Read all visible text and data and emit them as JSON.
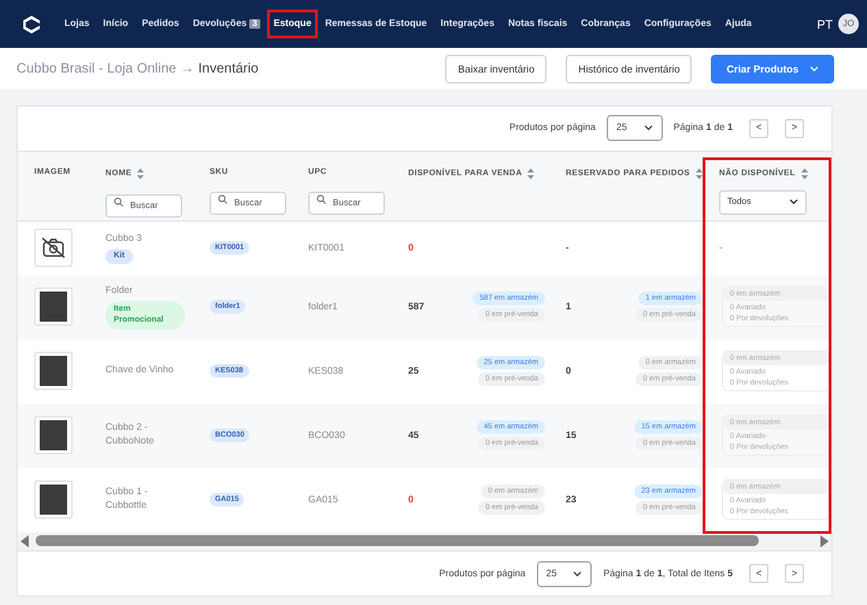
{
  "nav": {
    "items": [
      {
        "label": "Lojas",
        "selected": false,
        "highlighted": false
      },
      {
        "label": "Início",
        "selected": false,
        "highlighted": false
      },
      {
        "label": "Pedidos",
        "selected": false,
        "highlighted": false
      },
      {
        "label": "Devoluções",
        "badge": "3",
        "selected": false,
        "highlighted": false
      },
      {
        "label": "Estoque",
        "selected": true,
        "highlighted": true
      },
      {
        "label": "Remessas de Estoque",
        "selected": false,
        "highlighted": false
      },
      {
        "label": "Integrações",
        "selected": false,
        "highlighted": false
      },
      {
        "label": "Notas fiscais",
        "selected": false,
        "highlighted": false
      },
      {
        "label": "Cobranças",
        "selected": false,
        "highlighted": false
      },
      {
        "label": "Configurações",
        "selected": false,
        "highlighted": false
      },
      {
        "label": "Ajuda",
        "selected": false,
        "highlighted": false
      }
    ],
    "language": "PT",
    "avatar": "JO"
  },
  "header": {
    "breadcrumb": [
      "Cubbo Brasil - Loja Online",
      "→",
      "Inventário"
    ],
    "buttons": [
      {
        "label": "Baixar inventário",
        "kind": "outline"
      },
      {
        "label": "Histórico de inventário",
        "kind": "outline"
      },
      {
        "label": "Criar Produtos",
        "kind": "primary"
      }
    ]
  },
  "top_pagination": {
    "per_page_label": "Produtos por página",
    "per_page": "25",
    "page_text": "Página **1** de **1**",
    "prev": "<",
    "next": ">"
  },
  "table": {
    "highlight": {
      "kind": "last-column"
    },
    "columns": [
      {
        "label": "IMAGEM",
        "sortable": false
      },
      {
        "label": "NOME",
        "sortable": true,
        "filter": {
          "kind": "search",
          "placeholder": "Buscar"
        }
      },
      {
        "label": "SKU",
        "sortable": false,
        "filter": {
          "kind": "search",
          "placeholder": "Buscar"
        }
      },
      {
        "label": "UPC",
        "sortable": false,
        "filter": {
          "kind": "search",
          "placeholder": "Buscar"
        }
      },
      {
        "label": "DISPONÍVEL PARA VENDA",
        "sortable": true
      },
      {
        "label": "RESERVADO PARA PEDIDOS",
        "sortable": true
      },
      {
        "label": "NÃO DISPONÍVEL",
        "sortable": true,
        "filter": {
          "kind": "select",
          "value": "Todos"
        }
      }
    ],
    "rows": [
      {
        "kind": "no-image",
        "name": "Cubbo 3",
        "tag": {
          "label": "Kit",
          "kind": "kit"
        },
        "sku": "KIT0001",
        "upc": "KIT0001",
        "available": {
          "value": "0",
          "alert": true
        },
        "reserved": {
          "value": "-"
        },
        "unavailable": {
          "dash": "-"
        }
      },
      {
        "kind": "photo",
        "name": "Folder",
        "tag": {
          "label": "Item Promocional",
          "kind": "promo"
        },
        "sku": "folder1",
        "upc": "folder1",
        "available": {
          "value": "587",
          "alert": false,
          "pills": [
            {
              "label": "587 em armazém",
              "highlighted": true
            },
            {
              "label": "0 em pré-venda",
              "highlighted": false
            }
          ]
        },
        "reserved": {
          "value": "1",
          "pills": [
            {
              "label": "1 em armazém",
              "highlighted": true
            },
            {
              "label": "0 em pré-venda",
              "highlighted": false
            }
          ]
        },
        "unavailable": {
          "lines": [
            "0 em armazém",
            "0 Avariado",
            "0 Por devoluções"
          ]
        }
      },
      {
        "kind": "photo",
        "name": "Chave de Vinho",
        "sku": "KES038",
        "upc": "KES038",
        "available": {
          "value": "25",
          "alert": false,
          "pills": [
            {
              "label": "25 em armazém",
              "highlighted": true
            },
            {
              "label": "0 em pré-venda",
              "highlighted": false
            }
          ]
        },
        "reserved": {
          "value": "0",
          "pills": [
            {
              "label": "0 em armazém",
              "highlighted": false
            },
            {
              "label": "0 em pré-venda",
              "highlighted": false
            }
          ]
        },
        "unavailable": {
          "lines": [
            "0 em armazém",
            "0 Avariado",
            "0 Por devoluções"
          ]
        }
      },
      {
        "kind": "photo",
        "name": "Cubbo 2 - CubboNote",
        "sku": "BCO030",
        "upc": "BCO030",
        "available": {
          "value": "45",
          "alert": false,
          "pills": [
            {
              "label": "45 em armazém",
              "highlighted": true
            },
            {
              "label": "0 em pré-venda",
              "highlighted": false
            }
          ]
        },
        "reserved": {
          "value": "15",
          "pills": [
            {
              "label": "15 em armazém",
              "highlighted": true
            },
            {
              "label": "0 em pré-venda",
              "highlighted": false
            }
          ]
        },
        "unavailable": {
          "lines": [
            "0 em armazém",
            "0 Avariado",
            "0 Por devoluções"
          ]
        }
      },
      {
        "kind": "photo",
        "name": "Cubbo 1 - Cubbottle",
        "sku": "GA015",
        "upc": "GA015",
        "available": {
          "value": "0",
          "alert": true,
          "pills": [
            {
              "label": "0 em armazém",
              "highlighted": false
            },
            {
              "label": "0 em pré-venda",
              "highlighted": false
            }
          ]
        },
        "reserved": {
          "value": "23",
          "pills": [
            {
              "label": "23 em armazém",
              "highlighted": true
            },
            {
              "label": "0 em pré-venda",
              "highlighted": false
            }
          ]
        },
        "unavailable": {
          "lines": [
            "0 em armazém",
            "0 Avariado",
            "0 Por devoluções"
          ]
        }
      }
    ]
  },
  "bottom_pagination": {
    "per_page_label": "Produtos por página",
    "per_page": "25",
    "page_text": "Página **1** de **1**, Total de Itens **5**",
    "prev": "<",
    "next": ">"
  }
}
